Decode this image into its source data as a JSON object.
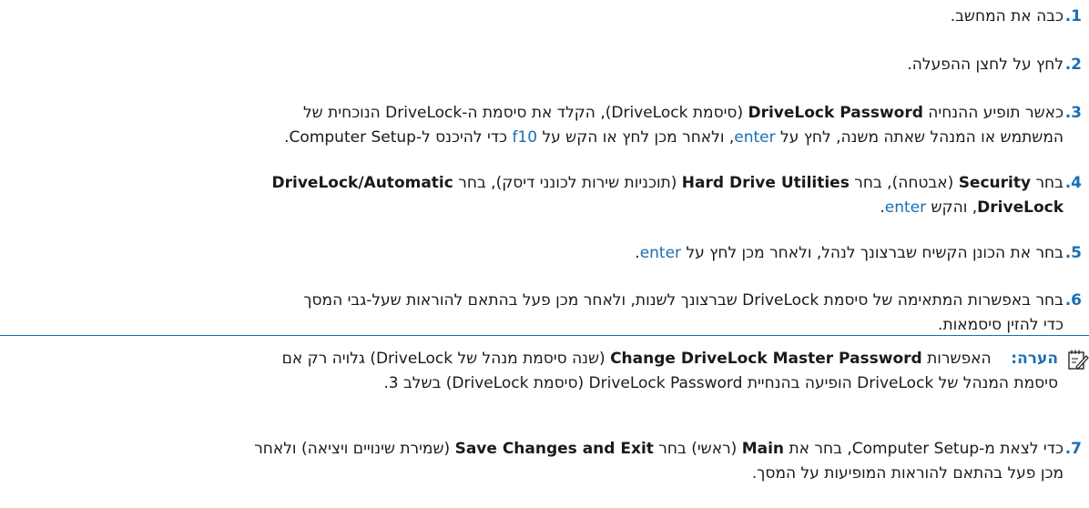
{
  "steps": [
    {
      "num": ".1",
      "text": "כבה את המחשב."
    },
    {
      "num": ".2",
      "text": "לחץ על לחצן ההפעלה."
    },
    {
      "num": ".3",
      "line1_a": "כאשר תופיע ההנחיה ",
      "line1_b": "DriveLock Password",
      "line1_c": " (סיסמת DriveLock), הקלד את סיסמת ה-DriveLock הנוכחית של",
      "line2_a": "המשתמש או המנהל שאתה משנה, לחץ על ",
      "line2_key1": "enter",
      "line2_b": ", ולאחר מכן לחץ או הקש על ",
      "line2_key2": "f10",
      "line2_c": " כדי להיכנס ל-Computer Setup."
    },
    {
      "num": ".4",
      "line1_a": "בחר ",
      "line1_b": "Security",
      "line1_c": " (אבטחה), בחר ",
      "line1_d": "Hard Drive Utilities",
      "line1_e": " (תוכניות שירות לכונני דיסק), בחר ",
      "line1_f": "DriveLock/Automatic",
      "line2_a": "DriveLock",
      "line2_b": ", והקש ",
      "line2_key": "enter",
      "line2_c": "."
    },
    {
      "num": ".5",
      "text_a": "בחר את הכונן הקשיח שברצונך לנהל, ולאחר מכן לחץ על ",
      "key": "enter",
      "text_b": "."
    },
    {
      "num": ".6",
      "line1": "בחר באפשרות המתאימה של סיסמת DriveLock שברצונך לשנות, ולאחר מכן פעל בהתאם להוראות שעל-גבי המסך",
      "line2": "כדי להזין סיסמאות."
    },
    {
      "num": ".7",
      "line1_a": "כדי לצאת מ-Computer Setup, בחר את ",
      "line1_b": "Main",
      "line1_c": " (ראשי) בחר ",
      "line1_d": "Save Changes and Exit",
      "line1_e": " (שמירת שינויים ויציאה) ולאחר",
      "line2": "מכן פעל בהתאם להוראות המופיעות על המסך."
    }
  ],
  "note": {
    "label": "הערה:",
    "line1_a": "האפשרות ",
    "line1_b": "Change DriveLock Master Password",
    "line1_c": " (שנה סיסמת מנהל של DriveLock) גלויה רק אם",
    "line2": "סיסמת המנהל של DriveLock הופיעה בהנחיית DriveLock Password (סיסמת DriveLock) בשלב 3.",
    "icon": "note-pencil-icon"
  }
}
